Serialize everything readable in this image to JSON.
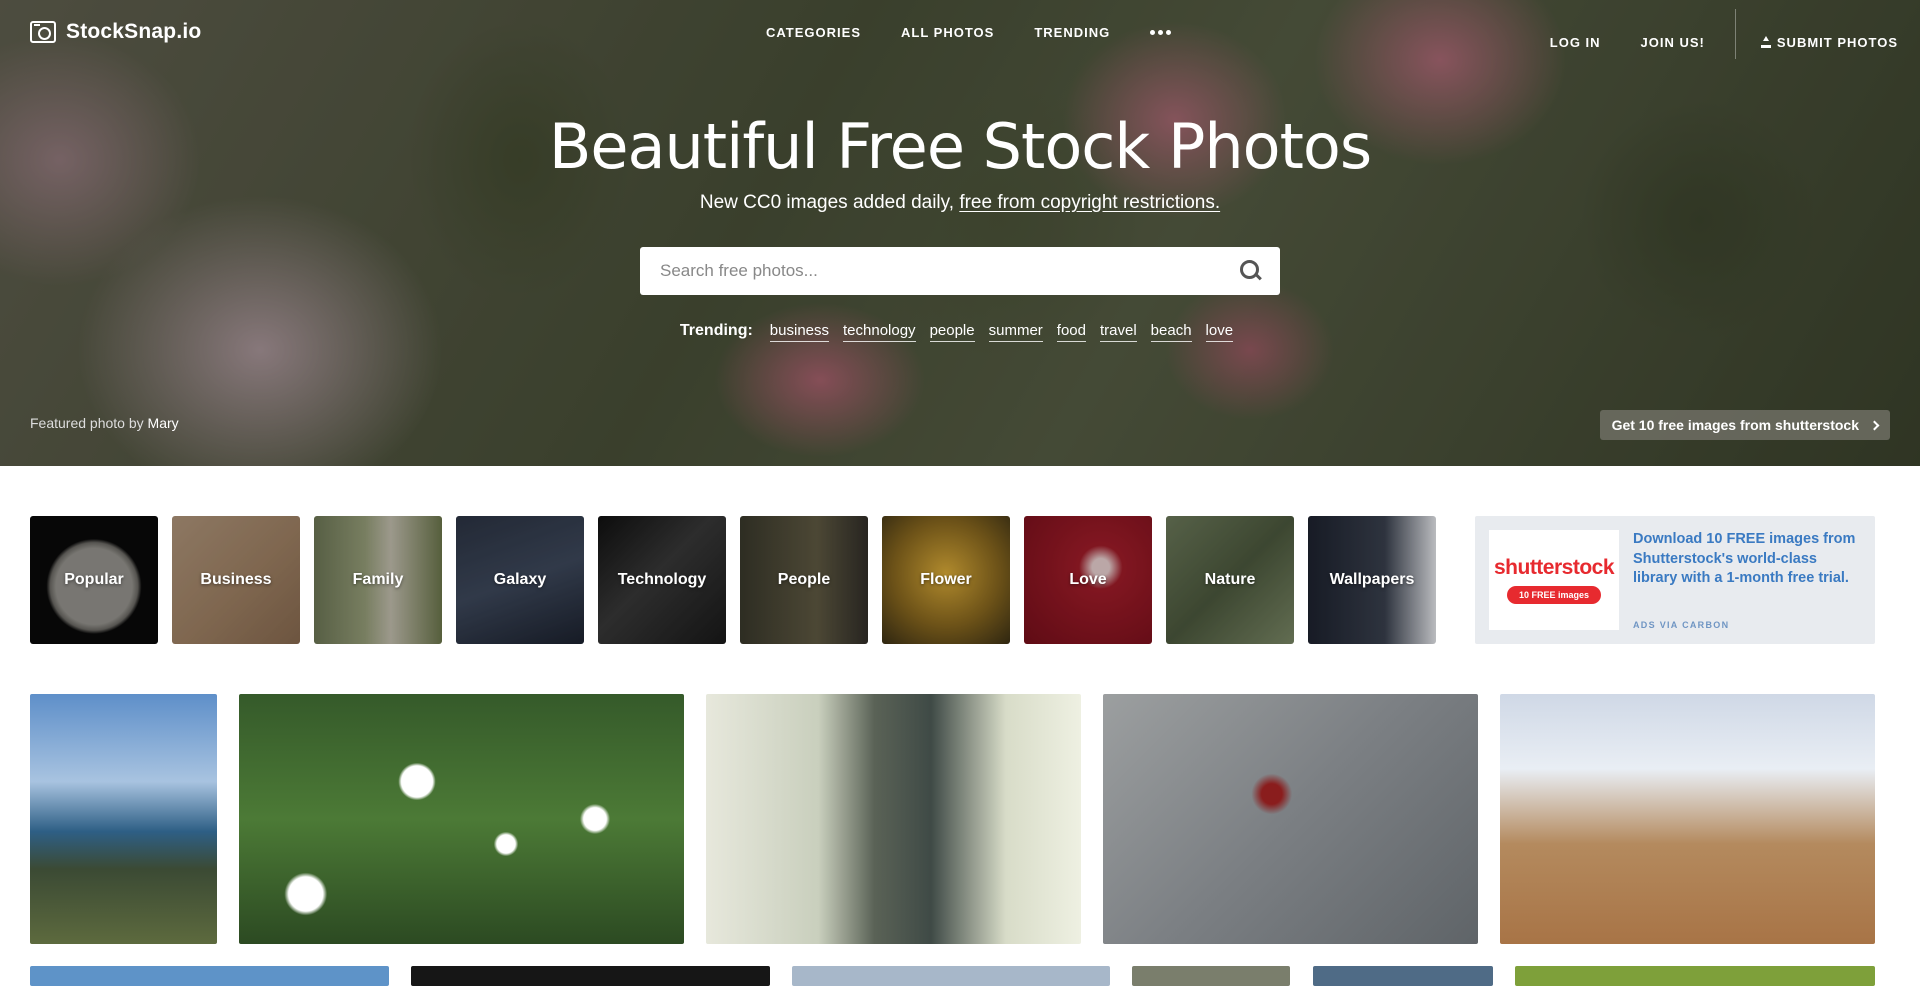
{
  "brand": {
    "name": "StockSnap.io"
  },
  "nav": {
    "center": [
      "CATEGORIES",
      "ALL PHOTOS",
      "TRENDING"
    ],
    "login": "LOG IN",
    "join": "JOIN US!",
    "submit": "SUBMIT PHOTOS"
  },
  "hero": {
    "title": "Beautiful Free Stock Photos",
    "subtitle_prefix": "New CC0 images added daily,",
    "subtitle_link": "free from copyright restrictions.",
    "search_placeholder": "Search free photos...",
    "trending_label": "Trending:",
    "trending_tags": [
      "business",
      "technology",
      "people",
      "summer",
      "food",
      "travel",
      "beach",
      "love"
    ],
    "featured_prefix": "Featured photo by",
    "featured_author": "Mary",
    "shutterstock_button": "Get 10 free images from shutterstock"
  },
  "categories": [
    "Popular",
    "Business",
    "Family",
    "Galaxy",
    "Technology",
    "People",
    "Flower",
    "Love",
    "Nature",
    "Wallpapers"
  ],
  "ad": {
    "logo": "shutterstock",
    "pill": "10 FREE images",
    "text": "Download 10 FREE images from Shutterstock's world-class library with a 1-month free trial.",
    "via": "ADS VIA CARBON"
  }
}
